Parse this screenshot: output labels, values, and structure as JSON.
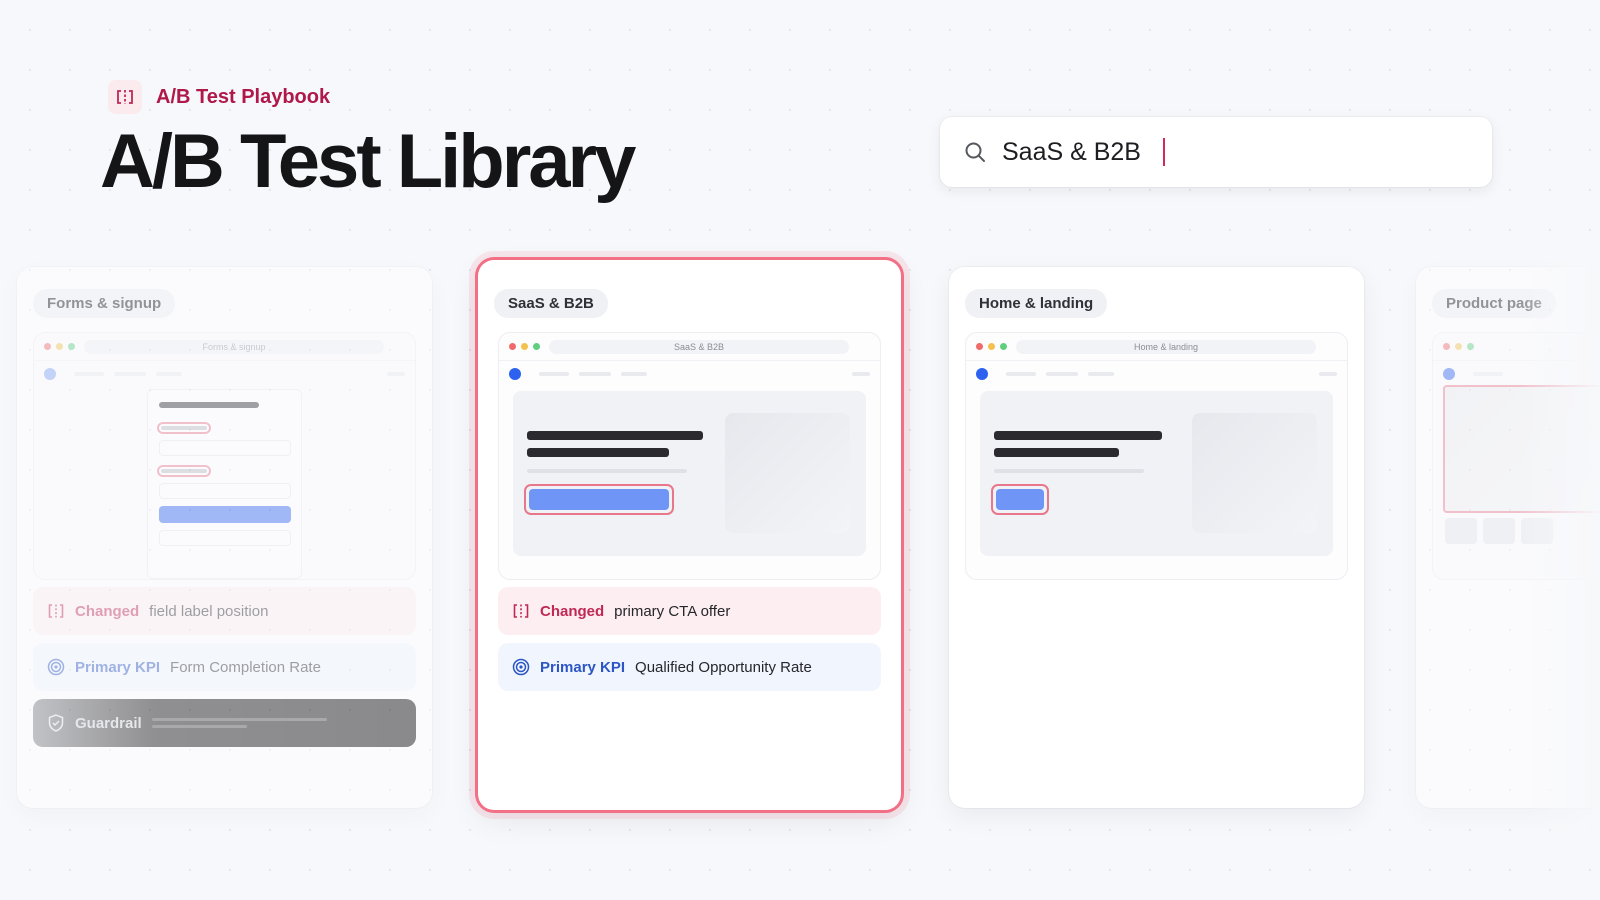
{
  "app": {
    "brand_label": "A/B Test Playbook",
    "brand_icon": "ab-split-icon",
    "title": "A/B Test Library"
  },
  "search": {
    "value": "SaaS & B2B",
    "icon": "search-icon"
  },
  "colors": {
    "accent": "#d42a5b",
    "active_border": "#f26f86",
    "kpi": "#2b56c4",
    "cta_blue": "#2d62f0"
  },
  "cards": [
    {
      "tag": "Forms & signup",
      "mock_url": "Forms & signup",
      "changed_label": "Changed",
      "changed_value": "field label position",
      "kpi_label": "Primary KPI",
      "kpi_value": "Form Completion Rate",
      "guardrail_label": "Guardrail"
    },
    {
      "tag": "SaaS & B2B",
      "mock_url": "SaaS & B2B",
      "changed_label": "Changed",
      "changed_value": "primary CTA offer",
      "kpi_label": "Primary KPI",
      "kpi_value": "Qualified Opportunity Rate",
      "selected": true
    },
    {
      "tag": "Home & landing",
      "mock_url": "Home & landing"
    },
    {
      "tag": "Product page"
    }
  ]
}
